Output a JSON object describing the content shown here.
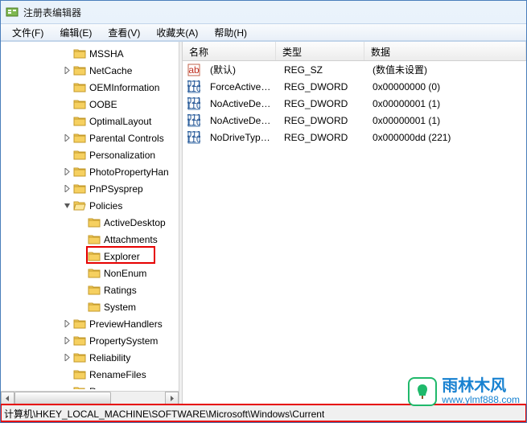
{
  "window": {
    "title": "注册表编辑器"
  },
  "menu": {
    "file": "文件(F)",
    "edit": "编辑(E)",
    "view": "查看(V)",
    "favorites": "收藏夹(A)",
    "help": "帮助(H)"
  },
  "tree": {
    "items": [
      {
        "depth": 3,
        "exp": "",
        "label": "MSSHA"
      },
      {
        "depth": 3,
        "exp": "collapsed",
        "label": "NetCache"
      },
      {
        "depth": 3,
        "exp": "",
        "label": "OEMInformation"
      },
      {
        "depth": 3,
        "exp": "",
        "label": "OOBE"
      },
      {
        "depth": 3,
        "exp": "",
        "label": "OptimalLayout"
      },
      {
        "depth": 3,
        "exp": "collapsed",
        "label": "Parental Controls"
      },
      {
        "depth": 3,
        "exp": "",
        "label": "Personalization"
      },
      {
        "depth": 3,
        "exp": "collapsed",
        "label": "PhotoPropertyHan"
      },
      {
        "depth": 3,
        "exp": "collapsed",
        "label": "PnPSysprep"
      },
      {
        "depth": 3,
        "exp": "expanded",
        "label": "Policies"
      },
      {
        "depth": 4,
        "exp": "",
        "label": "ActiveDesktop"
      },
      {
        "depth": 4,
        "exp": "",
        "label": "Attachments"
      },
      {
        "depth": 4,
        "exp": "",
        "label": "Explorer",
        "highlighted": true
      },
      {
        "depth": 4,
        "exp": "",
        "label": "NonEnum"
      },
      {
        "depth": 4,
        "exp": "",
        "label": "Ratings"
      },
      {
        "depth": 4,
        "exp": "",
        "label": "System"
      },
      {
        "depth": 3,
        "exp": "collapsed",
        "label": "PreviewHandlers"
      },
      {
        "depth": 3,
        "exp": "collapsed",
        "label": "PropertySystem"
      },
      {
        "depth": 3,
        "exp": "collapsed",
        "label": "Reliability"
      },
      {
        "depth": 3,
        "exp": "",
        "label": "RenameFiles"
      },
      {
        "depth": 3,
        "exp": "expanded",
        "label": "Run"
      }
    ]
  },
  "list": {
    "columns": {
      "name": "名称",
      "type": "类型",
      "data": "数据"
    },
    "rows": [
      {
        "icon": "string",
        "name": "(默认)",
        "type": "REG_SZ",
        "data": "(数值未设置)"
      },
      {
        "icon": "binary",
        "name": "ForceActiveDe...",
        "type": "REG_DWORD",
        "data": "0x00000000 (0)"
      },
      {
        "icon": "binary",
        "name": "NoActiveDeskt...",
        "type": "REG_DWORD",
        "data": "0x00000001 (1)"
      },
      {
        "icon": "binary",
        "name": "NoActiveDeskt...",
        "type": "REG_DWORD",
        "data": "0x00000001 (1)"
      },
      {
        "icon": "binary",
        "name": "NoDriveTypeA...",
        "type": "REG_DWORD",
        "data": "0x000000dd (221)"
      }
    ]
  },
  "statusbar": {
    "path": "计算机\\HKEY_LOCAL_MACHINE\\SOFTWARE\\Microsoft\\Windows\\Current"
  },
  "watermark": {
    "brand": "雨林木风",
    "url": "www.ylmf888.com"
  }
}
